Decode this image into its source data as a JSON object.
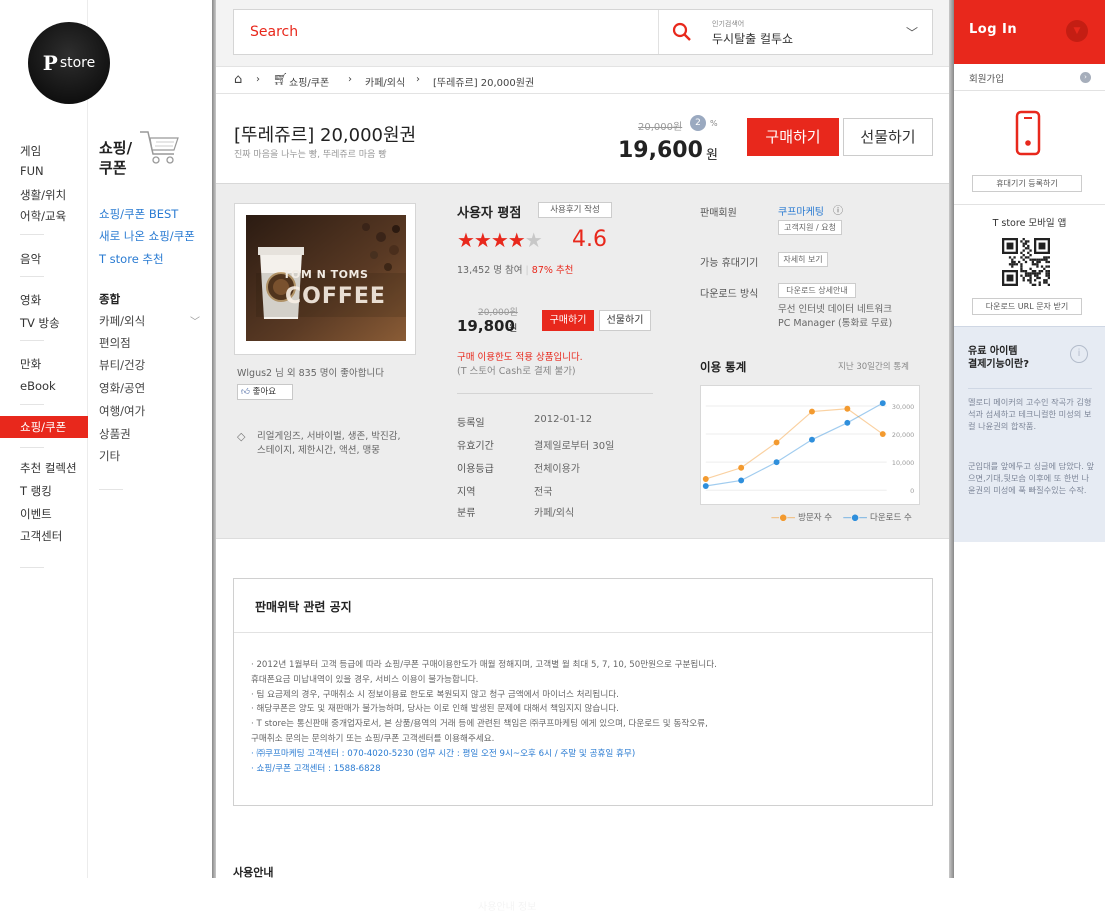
{
  "logo": {
    "mark": "P",
    "text": "store"
  },
  "nav_primary": [
    {
      "label": "게임"
    },
    {
      "label": "FUN"
    },
    {
      "label": "생활/위치"
    },
    {
      "label": "어학/교육"
    },
    {
      "label": "음악"
    },
    {
      "label": "영화"
    },
    {
      "label": "TV 방송"
    },
    {
      "label": "만화"
    },
    {
      "label": "eBook"
    },
    {
      "label": "쇼핑/쿠폰",
      "active": true
    },
    {
      "label": "추천 컬렉션"
    },
    {
      "label": "T 랭킹"
    },
    {
      "label": "이벤트"
    },
    {
      "label": "고객센터"
    }
  ],
  "nav_secondary": {
    "title": "쇼핑/ 쿠폰",
    "links": [
      "쇼핑/쿠폰 BEST",
      "새로 나온 쇼핑/쿠폰",
      "T store 추천"
    ],
    "heading": "종합",
    "items": [
      "카페/외식",
      "편의점",
      "뷰티/건강",
      "영화/공연",
      "여행/여가",
      "상품권",
      "기타"
    ]
  },
  "search": {
    "placeholder": "Search",
    "popular_label": "인기검색어",
    "popular_value": "두시탈출 컬투쇼"
  },
  "breadcrumb": [
    "쇼핑/쿠폰",
    "카페/외식",
    "[뚜레쥬르] 20,000원권"
  ],
  "product": {
    "title": "[뚜레쥬르] 20,000원권",
    "subtitle": "진짜 마음을 나누는 빵, 뚜레쥬르 마음 빵",
    "original_price": "20,000원",
    "discount": "2",
    "discount_unit": "%",
    "price": "19,600",
    "price_unit": "원",
    "buy_label": "구매하기",
    "gift_label": "선물하기",
    "image_text_1": "TOM N TOMS",
    "image_text_2": "COFFEE"
  },
  "likes": {
    "text": "Wlgus2 님 외 835 명이 좋아합니다",
    "button": "좋아요"
  },
  "tags": "리얼게임즈, 서바이벌, 생존, 박진감, 스테이지, 제한시간, 액션, 맹몽",
  "rating": {
    "title": "사용자 평점",
    "review_btn": "사용후기 작성",
    "stars_filled": 4,
    "stars_total": 5,
    "score": "4.6",
    "participants": "13,452 명 참여",
    "recommend": "87% 추천"
  },
  "mini_price": {
    "original": "20,000원",
    "price": "19,800",
    "unit": "원",
    "buy": "구매하기",
    "gift": "선물하기",
    "limit": "구매 이용한도 적용 상품입니다.",
    "limit_note": "(T 스토어 Cash로 결제 불가)"
  },
  "info": [
    {
      "k": "등록일",
      "v": "2012-01-12"
    },
    {
      "k": "유효기간",
      "v": "결제일로부터 30일"
    },
    {
      "k": "이용등급",
      "v": "전체이용가"
    },
    {
      "k": "지역",
      "v": "전국"
    },
    {
      "k": "분류",
      "v": "카페/외식"
    }
  ],
  "seller": {
    "label": "판매회원",
    "name": "쿠프마케팅",
    "info_icon": "ⓘ",
    "support_btn": "고객지원 / 요청",
    "device_label": "가능 휴대기기",
    "device_btn": "자세히 보기",
    "download_label": "다운로드 방식",
    "download_btn": "다운로드 상세안내",
    "download_desc_1": "무선 인터넷 데이터 네트워크",
    "download_desc_2": "PC Manager (통화료 무료)"
  },
  "stats": {
    "title": "이용 통계",
    "subtitle": "지난 30일간의 통계",
    "legend_visitors": "방문자 수",
    "legend_downloads": "다운로드 수"
  },
  "chart_data": {
    "type": "line",
    "x": [
      1,
      2,
      3,
      4,
      5,
      6
    ],
    "ylim": [
      0,
      35000
    ],
    "yticks": [
      "30,000",
      "20,000",
      "10,000",
      "0"
    ],
    "series": [
      {
        "name": "방문자 수",
        "color": "#f39a2f",
        "values": [
          4000,
          8000,
          17000,
          28000,
          29000,
          20000
        ]
      },
      {
        "name": "다운로드 수",
        "color": "#2f8fdc",
        "values": [
          1500,
          3500,
          10000,
          18000,
          24000,
          31000
        ]
      }
    ]
  },
  "notice": {
    "title": "판매위탁 관련 공지",
    "lines": [
      "· 2012년 1월부터 고객 등급에 따라 쇼핑/쿠폰 구매이용한도가 매월 정해지며, 고객별 월 최대 5, 7, 10, 50만원으로 구분됩니다.",
      "   휴대폰요금 미납내역이 있을 경우, 서비스 이용이 불가능합니다.",
      "· 팀 요금제의 경우, 구매취소 시 정보이용료 한도로 복원되지 않고 청구 금액에서 마이너스 처리됩니다.",
      "· 해당쿠폰은 양도 및 재판매가 불가능하며, 당사는 이로 인해 발생된 문제에 대해서 책임지지 않습니다.",
      "· T store는 통신판매 중개업자로서, 본 상품/용역의 거래 등에 관련된 책임은 ㈜쿠프마케팅 에게 있으며, 다운로드 및 동작오류,",
      "   구매취소 문의는 문의하기 또는 쇼핑/쿠폰 고객센터를 이용해주세요."
    ],
    "blue_lines": [
      "· ㈜쿠프마케팅 고객센터 : 070-4020-5230 (업무 시간 : 평일 오전 9시~오후 6시 / 주말 및 공휴일 휴무)",
      "· 쇼핑/쿠폰 고객센터 : 1588-6828"
    ]
  },
  "usage_title": "사용안내",
  "sidebar": {
    "login": "Log In",
    "join": "회원가입",
    "register_device": "휴대기기 등록하기",
    "app_title": "T store 모바일 앱",
    "url_btn": "다운로드 URL 문자 받기",
    "pay_title_1": "유료 아이템",
    "pay_title_2": "결제기능이란?",
    "pay_p1": "멜로디 메이커의 고수인 작곡가 김형석과 섬세하고 테크니컬한 미성의 보컬 나윤권의 합작품.",
    "pay_p2": "군입대를 앞에두고 싱글에 담았다. 앞으면,기대,뒷모습 이후에 또 한번 나윤권의 미성에 푹 빠질수있는 수작."
  },
  "footer_text": "사용안내 정보"
}
